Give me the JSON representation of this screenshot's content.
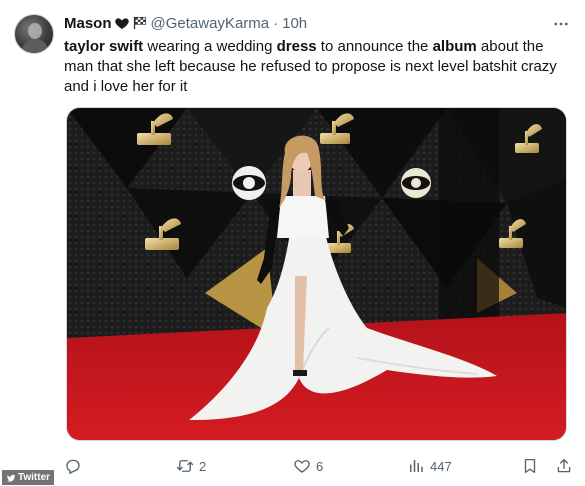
{
  "author": {
    "display_name": "Mason",
    "handle": "@GetawayKarma",
    "separator": "·",
    "time": "10h"
  },
  "tweet": {
    "segments": [
      {
        "text": "taylor swift",
        "bold": true
      },
      {
        "text": " wearing a wedding ",
        "bold": false
      },
      {
        "text": "dress",
        "bold": true
      },
      {
        "text": " to announce the ",
        "bold": false
      },
      {
        "text": "album",
        "bold": true
      },
      {
        "text": " about the man that she left because he refused to propose is next level batshit crazy and i love her for it",
        "bold": false
      }
    ]
  },
  "actions": {
    "reply_count": "",
    "retweet_count": "2",
    "like_count": "6",
    "views_count": "447"
  },
  "watermark": {
    "label": "Twitter"
  },
  "icons": {
    "more": "more-dots-icon",
    "reply": "reply-icon",
    "retweet": "retweet-icon",
    "like": "heart-icon",
    "views": "views-icon",
    "bookmark": "bookmark-icon",
    "share": "share-icon",
    "name_emoji_1": "black-heart-icon",
    "name_emoji_2": "checkered-flag-icon"
  },
  "colors": {
    "text_primary": "#0f1419",
    "text_secondary": "#536471",
    "red_carpet": "#c8161d"
  }
}
